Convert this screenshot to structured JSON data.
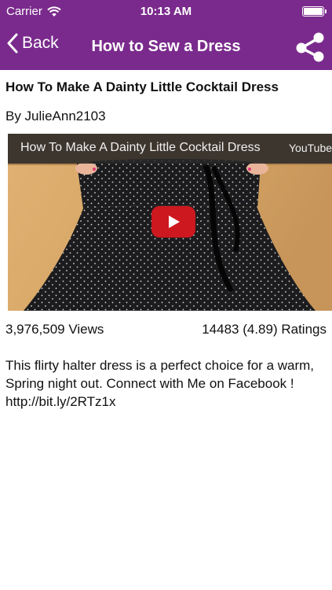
{
  "status_bar": {
    "carrier": "Carrier",
    "time": "10:13 AM"
  },
  "nav": {
    "back_label": "Back",
    "title": "How to Sew a Dress",
    "share_icon": "share-icon"
  },
  "video": {
    "title": "How To Make A Dainty Little Cocktail Dress",
    "author": "By JulieAnn2103",
    "player_title": "How To Make A Dainty Little Cocktail Dress",
    "player_brand": "YouTube",
    "views": "3,976,509 Views",
    "ratings": "14483 (4.89) Ratings",
    "description": "This flirty halter dress is a perfect choice for a warm, Spring night out. Connect with Me on Facebook ! http://bit.ly/2RTz1x"
  },
  "colors": {
    "accent": "#7a2a8c",
    "play_red": "#cc181e"
  }
}
